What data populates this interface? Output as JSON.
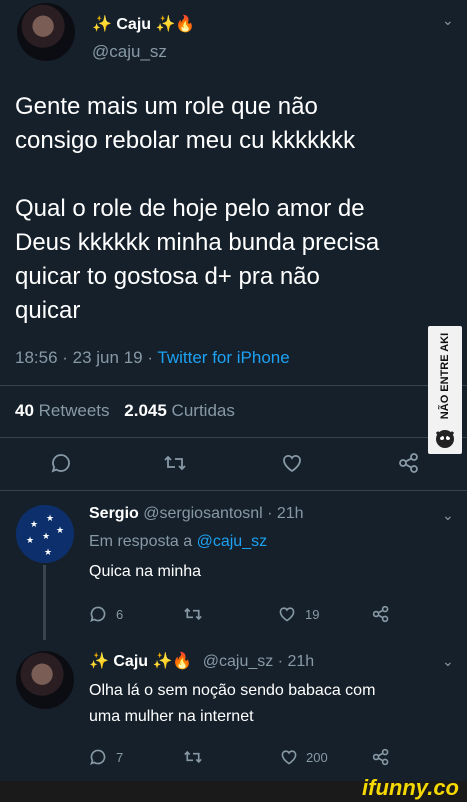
{
  "main_tweet": {
    "display_name": "✨ Caju ✨🔥",
    "handle": "@caju_sz",
    "text_line1": "Gente mais um role que não",
    "text_line2": "consigo rebolar meu cu kkkkkkk",
    "text_line3": "Qual o role de hoje pelo amor de",
    "text_line4": "Deus kkkkkk minha bunda precisa",
    "text_line5": "quicar to gostosa d+ pra não",
    "text_line6": "quicar",
    "time": "18:56 · 23 jun 19 · ",
    "source": "Twitter for iPhone",
    "retweets_count": "40",
    "retweets_label": "Retweets",
    "likes_count": "2.045",
    "likes_label": "Curtidas"
  },
  "reply1": {
    "display_name": "Sergio",
    "handle_time": "@sergiosantosnl · 21h",
    "reply_to_prefix": "Em resposta a ",
    "reply_to_handle": "@caju_sz",
    "text": "Quica na minha",
    "reply_count": "6",
    "like_count": "19"
  },
  "reply2": {
    "display_name": "✨ Caju ✨🔥",
    "handle_time": "@caju_sz · 21h",
    "text_line1": "Olha lá o sem noção sendo babaca com",
    "text_line2": "uma mulher na internet",
    "reply_count": "7",
    "like_count": "200"
  },
  "watermarks": {
    "side": "NÃO ENTRE AKI",
    "bottom": "ifunny.co"
  },
  "colors": {
    "background": "#15202b",
    "muted": "#8899a6",
    "link": "#1da1f2",
    "divider": "#38444d"
  }
}
